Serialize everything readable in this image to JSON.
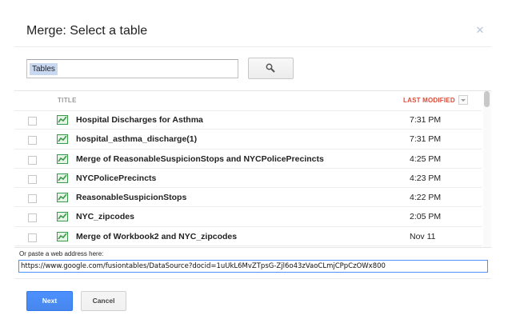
{
  "dialog": {
    "title": "Merge: Select a table",
    "close_icon": "close-icon"
  },
  "search": {
    "chip_label": "Tables",
    "button_icon": "search-icon"
  },
  "table": {
    "columns": {
      "title": "TITLE",
      "modified": "LAST MODIFIED"
    },
    "sort_icon": "chevron-down-icon",
    "rows": [
      {
        "name": "Hospital Discharges for Asthma",
        "modified": "7:31 PM"
      },
      {
        "name": "hospital_asthma_discharge(1)",
        "modified": "7:31 PM"
      },
      {
        "name": "Merge of ReasonableSuspicionStops and NYCPolicePrecincts",
        "modified": "4:25 PM"
      },
      {
        "name": "NYCPolicePrecincts",
        "modified": "4:23 PM"
      },
      {
        "name": "ReasonableSuspicionStops",
        "modified": "4:22 PM"
      },
      {
        "name": "NYC_zipcodes",
        "modified": "2:05 PM"
      },
      {
        "name": "Merge of Workbook2 and NYC_zipcodes",
        "modified": "Nov 11"
      }
    ],
    "row_icon": "fusion-table-icon",
    "icon_color": "#3a9a4a"
  },
  "paste": {
    "label": "Or paste a web address here:",
    "value": "https://www.google.com/fusiontables/DataSource?docid=1uUkL6MvZTpsG-Zjl6o43zVaoCLmjCPpCzOWx800"
  },
  "buttons": {
    "next": "Next",
    "cancel": "Cancel"
  },
  "colors": {
    "primary": "#4d90fe",
    "accent": "#dd4b39"
  }
}
